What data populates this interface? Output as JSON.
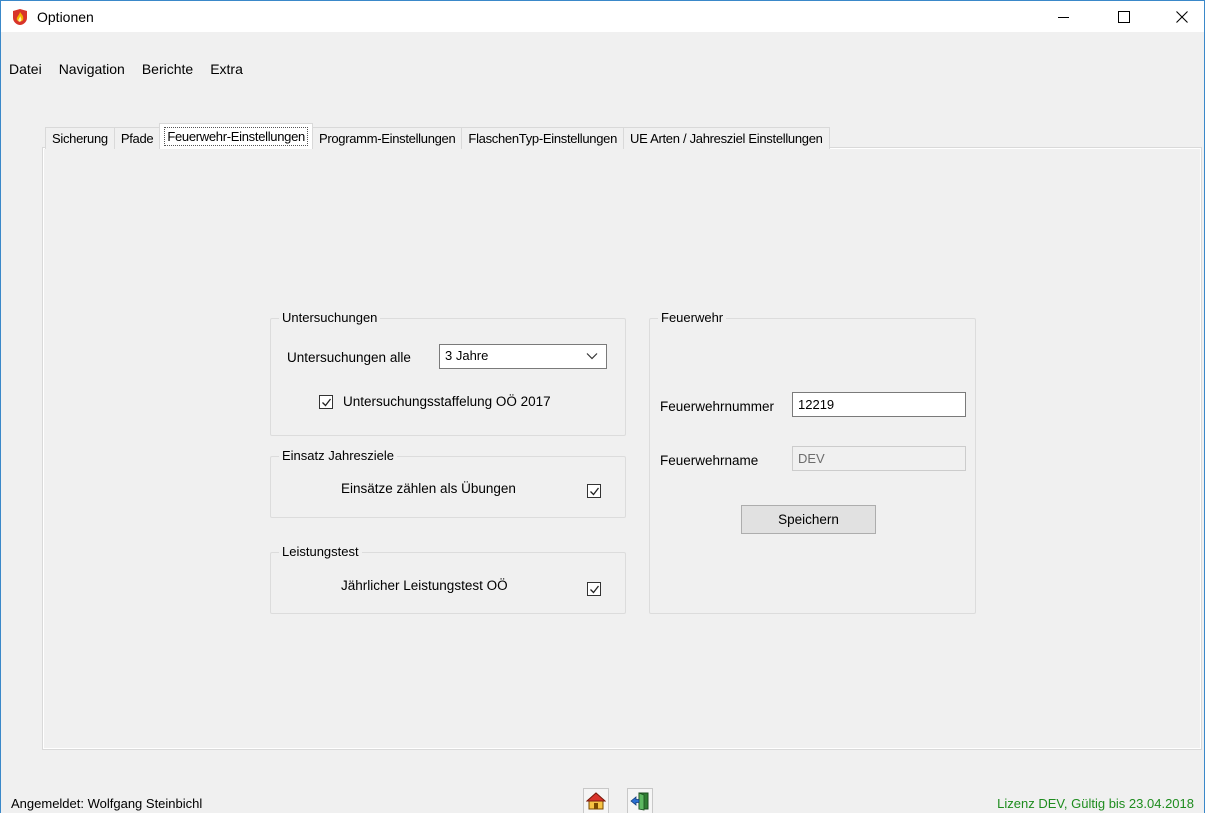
{
  "window": {
    "title": "Optionen",
    "minimize_icon": "minimize-icon",
    "maximize_icon": "maximize-icon",
    "close_icon": "close-icon"
  },
  "menu": [
    "Datei",
    "Navigation",
    "Berichte",
    "Extra"
  ],
  "tabs": [
    "Sicherung",
    "Pfade",
    "Feuerwehr-Einstellungen",
    "Programm-Einstellungen",
    "FlaschenTyp-Einstellungen",
    "UE Arten / Jahresziel Einstellungen"
  ],
  "active_tab": "Feuerwehr-Einstellungen",
  "untersuchungen": {
    "title": "Untersuchungen",
    "interval_label": "Untersuchungen alle",
    "interval_value": "3 Jahre",
    "staffelung_label": "Untersuchungsstaffelung OÖ 2017",
    "staffelung_checked": true
  },
  "einsatz": {
    "title": "Einsatz Jahresziele",
    "label": "Einsätze zählen als Übungen",
    "checked": true
  },
  "leistungstest": {
    "title": "Leistungstest",
    "label": "Jährlicher Leistungstest OÖ",
    "checked": true
  },
  "feuerwehr": {
    "title": "Feuerwehr",
    "nummer_label": "Feuerwehrnummer",
    "nummer_value": "12219",
    "name_label": "Feuerwehrname",
    "name_value": "DEV",
    "save_label": "Speichern"
  },
  "status": {
    "user": "Angemeldet: Wolfgang Steinbichl",
    "license": "Lizenz DEV, Gültig bis 23.04.2018"
  },
  "colors": {
    "license_text": "#1e8c1e",
    "window_border": "#3a88c9"
  }
}
